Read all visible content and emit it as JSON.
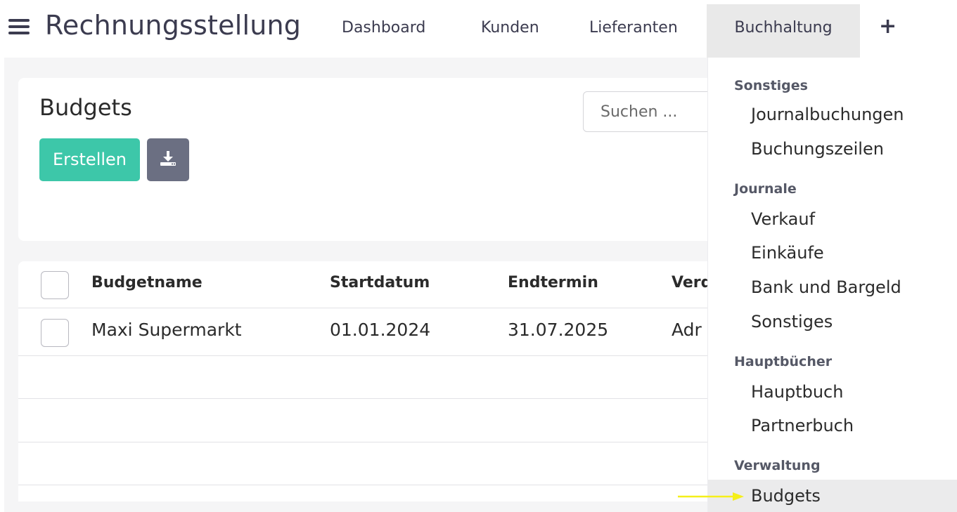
{
  "header": {
    "menu_icon": "hamburger-icon",
    "app_title": "Rechnungsstellung",
    "nav": {
      "dashboard": "Dashboard",
      "kunden": "Kunden",
      "lieferanten": "Lieferanten",
      "buchhaltung": "Buchhaltung",
      "add_icon": "plus-icon",
      "add_label": "+"
    },
    "active_nav": "Buchhaltung"
  },
  "page": {
    "title": "Budgets",
    "create_button": "Erstellen",
    "download_icon": "download-icon",
    "search_placeholder": "Suchen ..."
  },
  "table": {
    "columns": [
      "Budgetname",
      "Startdatum",
      "Endtermin",
      "Verd"
    ],
    "rows": [
      {
        "name": "Maxi Supermarkt",
        "start": "01.01.2024",
        "end": "31.07.2025",
        "extra": "Adr"
      }
    ]
  },
  "dropdown": {
    "sections": [
      {
        "title": "Sonstiges",
        "items": [
          "Journalbuchungen",
          "Buchungszeilen"
        ]
      },
      {
        "title": "Journale",
        "items": [
          "Verkauf",
          "Einkäufe",
          "Bank und Bargeld",
          "Sonstiges"
        ]
      },
      {
        "title": "Hauptbücher",
        "items": [
          "Hauptbuch",
          "Partnerbuch"
        ]
      },
      {
        "title": "Verwaltung",
        "items": [
          "Budgets"
        ]
      }
    ],
    "active_item": "Budgets"
  },
  "colors": {
    "primary": "#3dc7a9",
    "secondary": "#6b6f82",
    "annotation_arrow": "#f5ef1a",
    "active_bg": "#e9e9e9"
  }
}
